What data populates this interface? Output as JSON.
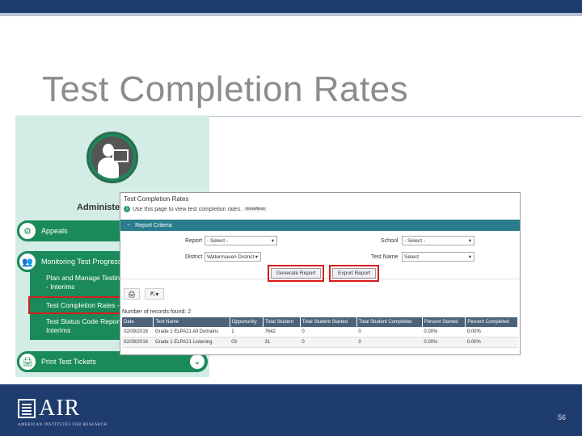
{
  "slide": {
    "title": "Test Completion Rates",
    "page_number": "56",
    "logo_text": "AIR",
    "logo_subtext": "AMERICAN INSTITUTES FOR RESEARCH"
  },
  "nav": {
    "section_title": "Administeri",
    "items": [
      {
        "label": "Appeals",
        "icon": "gear-icon"
      },
      {
        "label": "Monitoring Test Progress",
        "icon": "people-icon"
      },
      {
        "label": "Print Test Tickets",
        "icon": "printer-icon"
      }
    ],
    "sub_items": [
      "Plan and Manage Testing - Interims",
      "Test Completion Rates - S",
      "Test Status Code Report - Interims"
    ]
  },
  "report": {
    "title": "Test Completion Rates",
    "info_text": "Use this page to view test completion rates.",
    "more_less": "more/less",
    "criteria_label": "Report Criteria",
    "report_label": "Report",
    "report_value": "- Select -",
    "school_label": "School",
    "school_value": "- Select -",
    "district_label": "District",
    "district_value": "Watermaven District",
    "test_name_label": "Test Name",
    "test_name_value": "Select",
    "generate_button": "Generate Report",
    "export_button": "Export Report",
    "records_text": "Number of records found: 2",
    "columns": [
      "Date",
      "Test Name",
      "Opportunity",
      "Total Student",
      "Total Student Started",
      "Total Student Completed",
      "Percent Started",
      "Percent Completed"
    ],
    "rows": [
      [
        "02/09/2016",
        "Grade 1 ELPA21 All Domains",
        "1",
        "7642",
        "0",
        "0",
        "0.00%",
        "0.00%"
      ],
      [
        "02/09/2016",
        "Grade 1 ELPA21 Listening",
        "03",
        "31",
        "0",
        "0",
        "0.00%",
        "0.00%"
      ]
    ]
  },
  "colors": {
    "brand_navy": "#1f3c6e",
    "nav_green": "#1b8a5a",
    "highlight_red": "#d71c1c",
    "criteria_teal": "#2a7d8c",
    "table_header": "#4d6279"
  }
}
